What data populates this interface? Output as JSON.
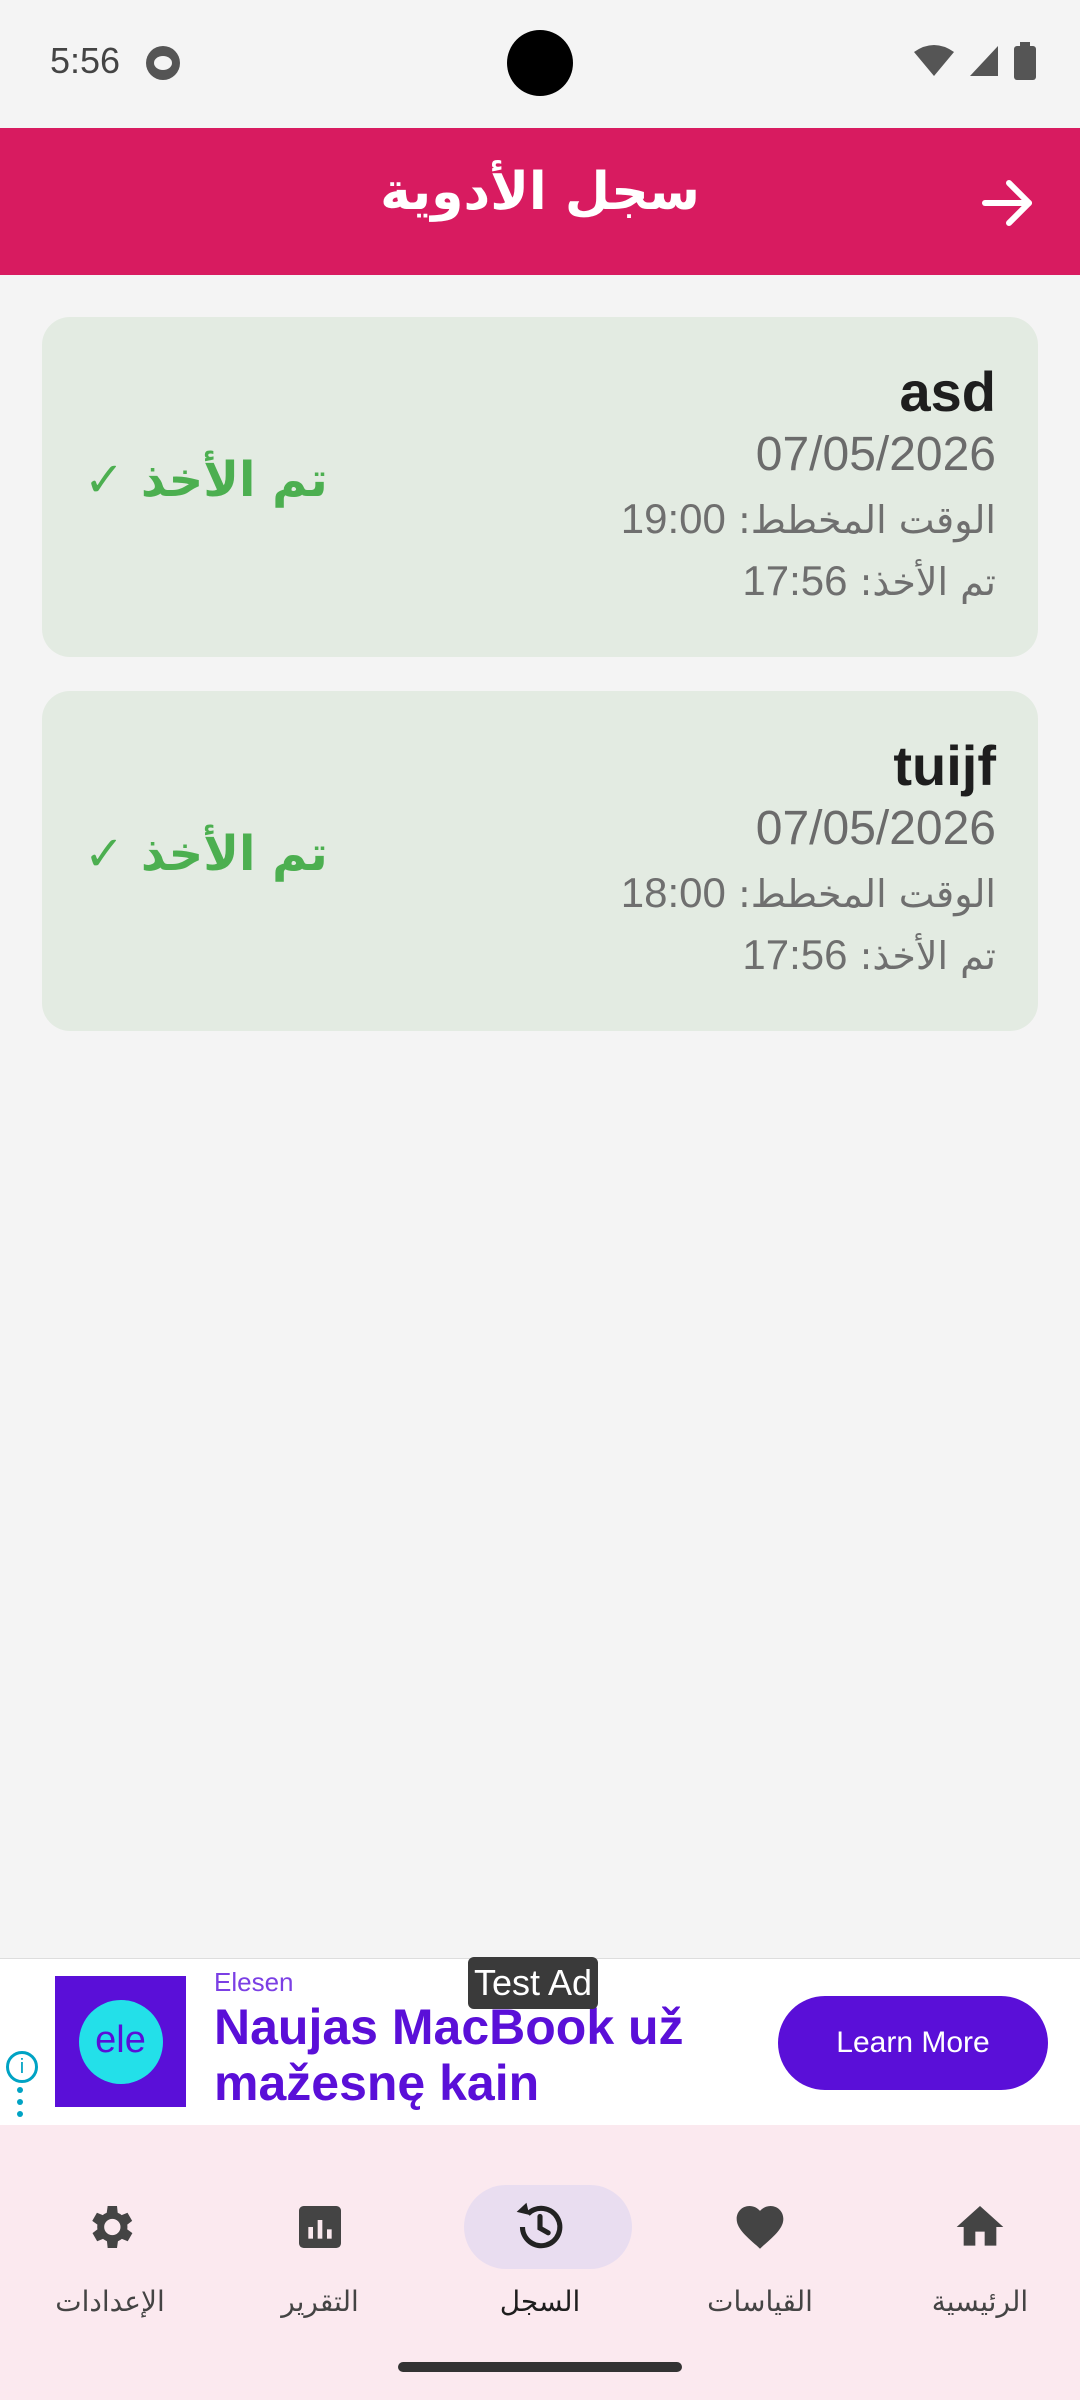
{
  "status_bar": {
    "time": "5:56"
  },
  "app_bar": {
    "title": "سجل الأدوية",
    "back_icon": "arrow-back-icon"
  },
  "records": [
    {
      "name": "asd",
      "date": "07/05/2026",
      "scheduled_label": "الوقت المخطط:",
      "scheduled_time": "19:00",
      "taken_label": "تم الأخذ:",
      "taken_time": "17:56",
      "status": "تم الأخذ ✓"
    },
    {
      "name": "tuijf",
      "date": "07/05/2026",
      "scheduled_label": "الوقت المخطط:",
      "scheduled_time": "18:00",
      "taken_label": "تم الأخذ:",
      "taken_time": "17:56",
      "status": "تم الأخذ ✓"
    }
  ],
  "ad": {
    "test_label": "Test Ad",
    "brand": "Elesen",
    "headline": "Naujas MacBook už mažesnę kain",
    "cta": "Learn More",
    "logo_text": "ele"
  },
  "bottom_nav": [
    {
      "label": "الإعدادات",
      "icon": "settings-icon",
      "active": false
    },
    {
      "label": "التقرير",
      "icon": "report-icon",
      "active": false
    },
    {
      "label": "السجل",
      "icon": "history-icon",
      "active": true
    },
    {
      "label": "القياسات",
      "icon": "heart-icon",
      "active": false
    },
    {
      "label": "الرئيسية",
      "icon": "home-icon",
      "active": false
    }
  ],
  "colors": {
    "app_bar": "#d81b60",
    "card_bg": "#e3ebe2",
    "taken_status": "#4caf50",
    "ad_accent": "#5a0fd8",
    "nav_bg": "#fbe9ef"
  }
}
